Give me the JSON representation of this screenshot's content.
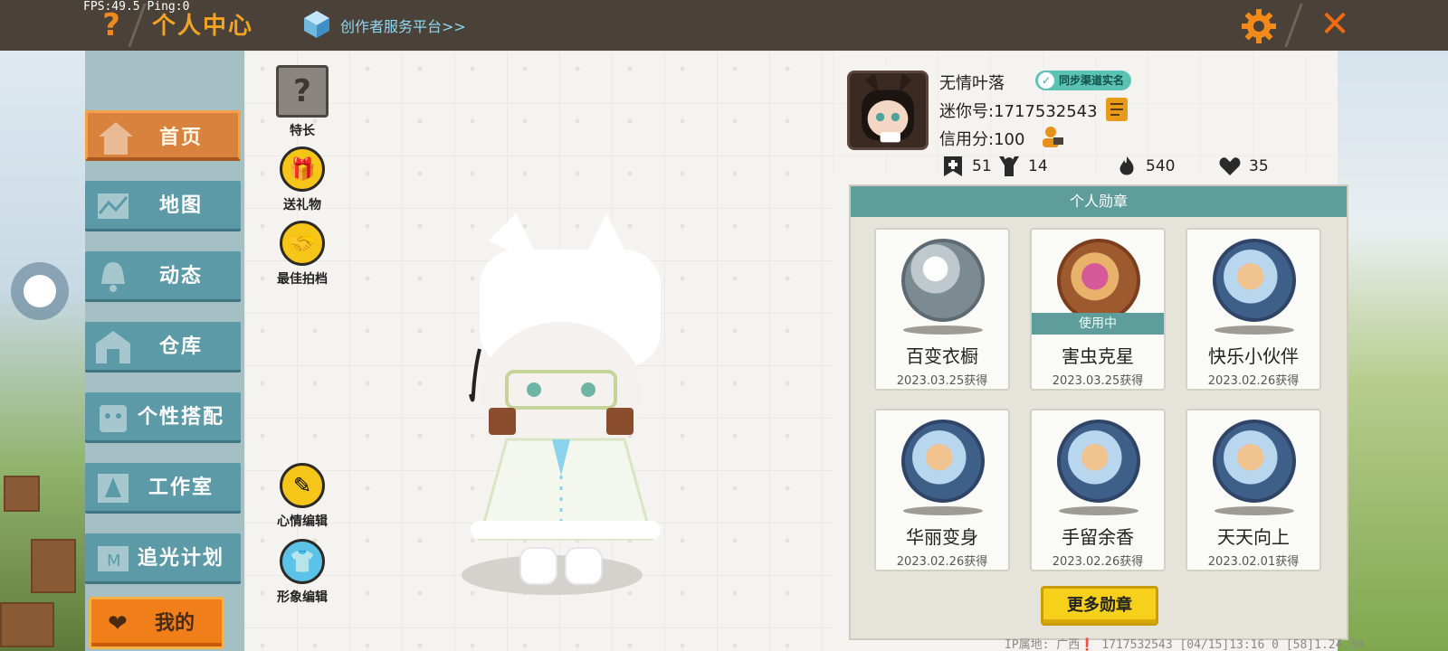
{
  "fps_text": "FPS:49.5  Ping:0",
  "title": "个人中心",
  "creator_link": "创作者服务平台>>",
  "icons": {
    "help": "help-icon",
    "close": "close-icon",
    "gear": "gear-icon"
  },
  "nav": {
    "items": [
      {
        "label": "首页",
        "icon": "house-icon",
        "active": true
      },
      {
        "label": "地图",
        "icon": "map-icon"
      },
      {
        "label": "动态",
        "icon": "bell-icon"
      },
      {
        "label": "仓库",
        "icon": "warehouse-icon"
      },
      {
        "label": "个性搭配",
        "icon": "outfit-icon"
      },
      {
        "label": "工作室",
        "icon": "studio-icon"
      },
      {
        "label": "追光计划",
        "icon": "light-icon"
      }
    ],
    "mine": {
      "label": "我的",
      "icon": "heart-icon"
    }
  },
  "side_actions": {
    "specialty": "特长",
    "gift": "送礼物",
    "partner": "最佳拍档",
    "mood_edit": "心情编辑",
    "image_edit": "形象编辑"
  },
  "profile": {
    "username": "无情叶落",
    "sync_badge": "同步渠道实名",
    "mini_id": "迷你号:1717532543",
    "credit": "信用分:100",
    "stats": {
      "add": "51",
      "fans": "14",
      "fire": "540",
      "likes": "35"
    }
  },
  "medals": {
    "header": "个人勋章",
    "in_use_label": "使用中",
    "items": [
      {
        "name": "百变衣橱",
        "date": "2023.03.25获得",
        "in_use": false
      },
      {
        "name": "害虫克星",
        "date": "2023.03.25获得",
        "in_use": true
      },
      {
        "name": "快乐小伙伴",
        "date": "2023.02.26获得",
        "in_use": false
      },
      {
        "name": "华丽变身",
        "date": "2023.02.26获得",
        "in_use": false
      },
      {
        "name": "手留余香",
        "date": "2023.02.26获得",
        "in_use": false
      },
      {
        "name": "天天向上",
        "date": "2023.02.01获得",
        "in_use": false
      }
    ],
    "more_button": "更多勋章"
  },
  "footer": {
    "ip_line": "IP属地: 广西❗   1717532543   [04/15]13:16 0  [58]1.24.30"
  },
  "colors": {
    "topbar": "#4a4238",
    "accent_orange": "#f5a322",
    "nav_teal": "#5d9aa7",
    "medal_header": "#5f9c9c",
    "more_button": "#f7d01b"
  }
}
